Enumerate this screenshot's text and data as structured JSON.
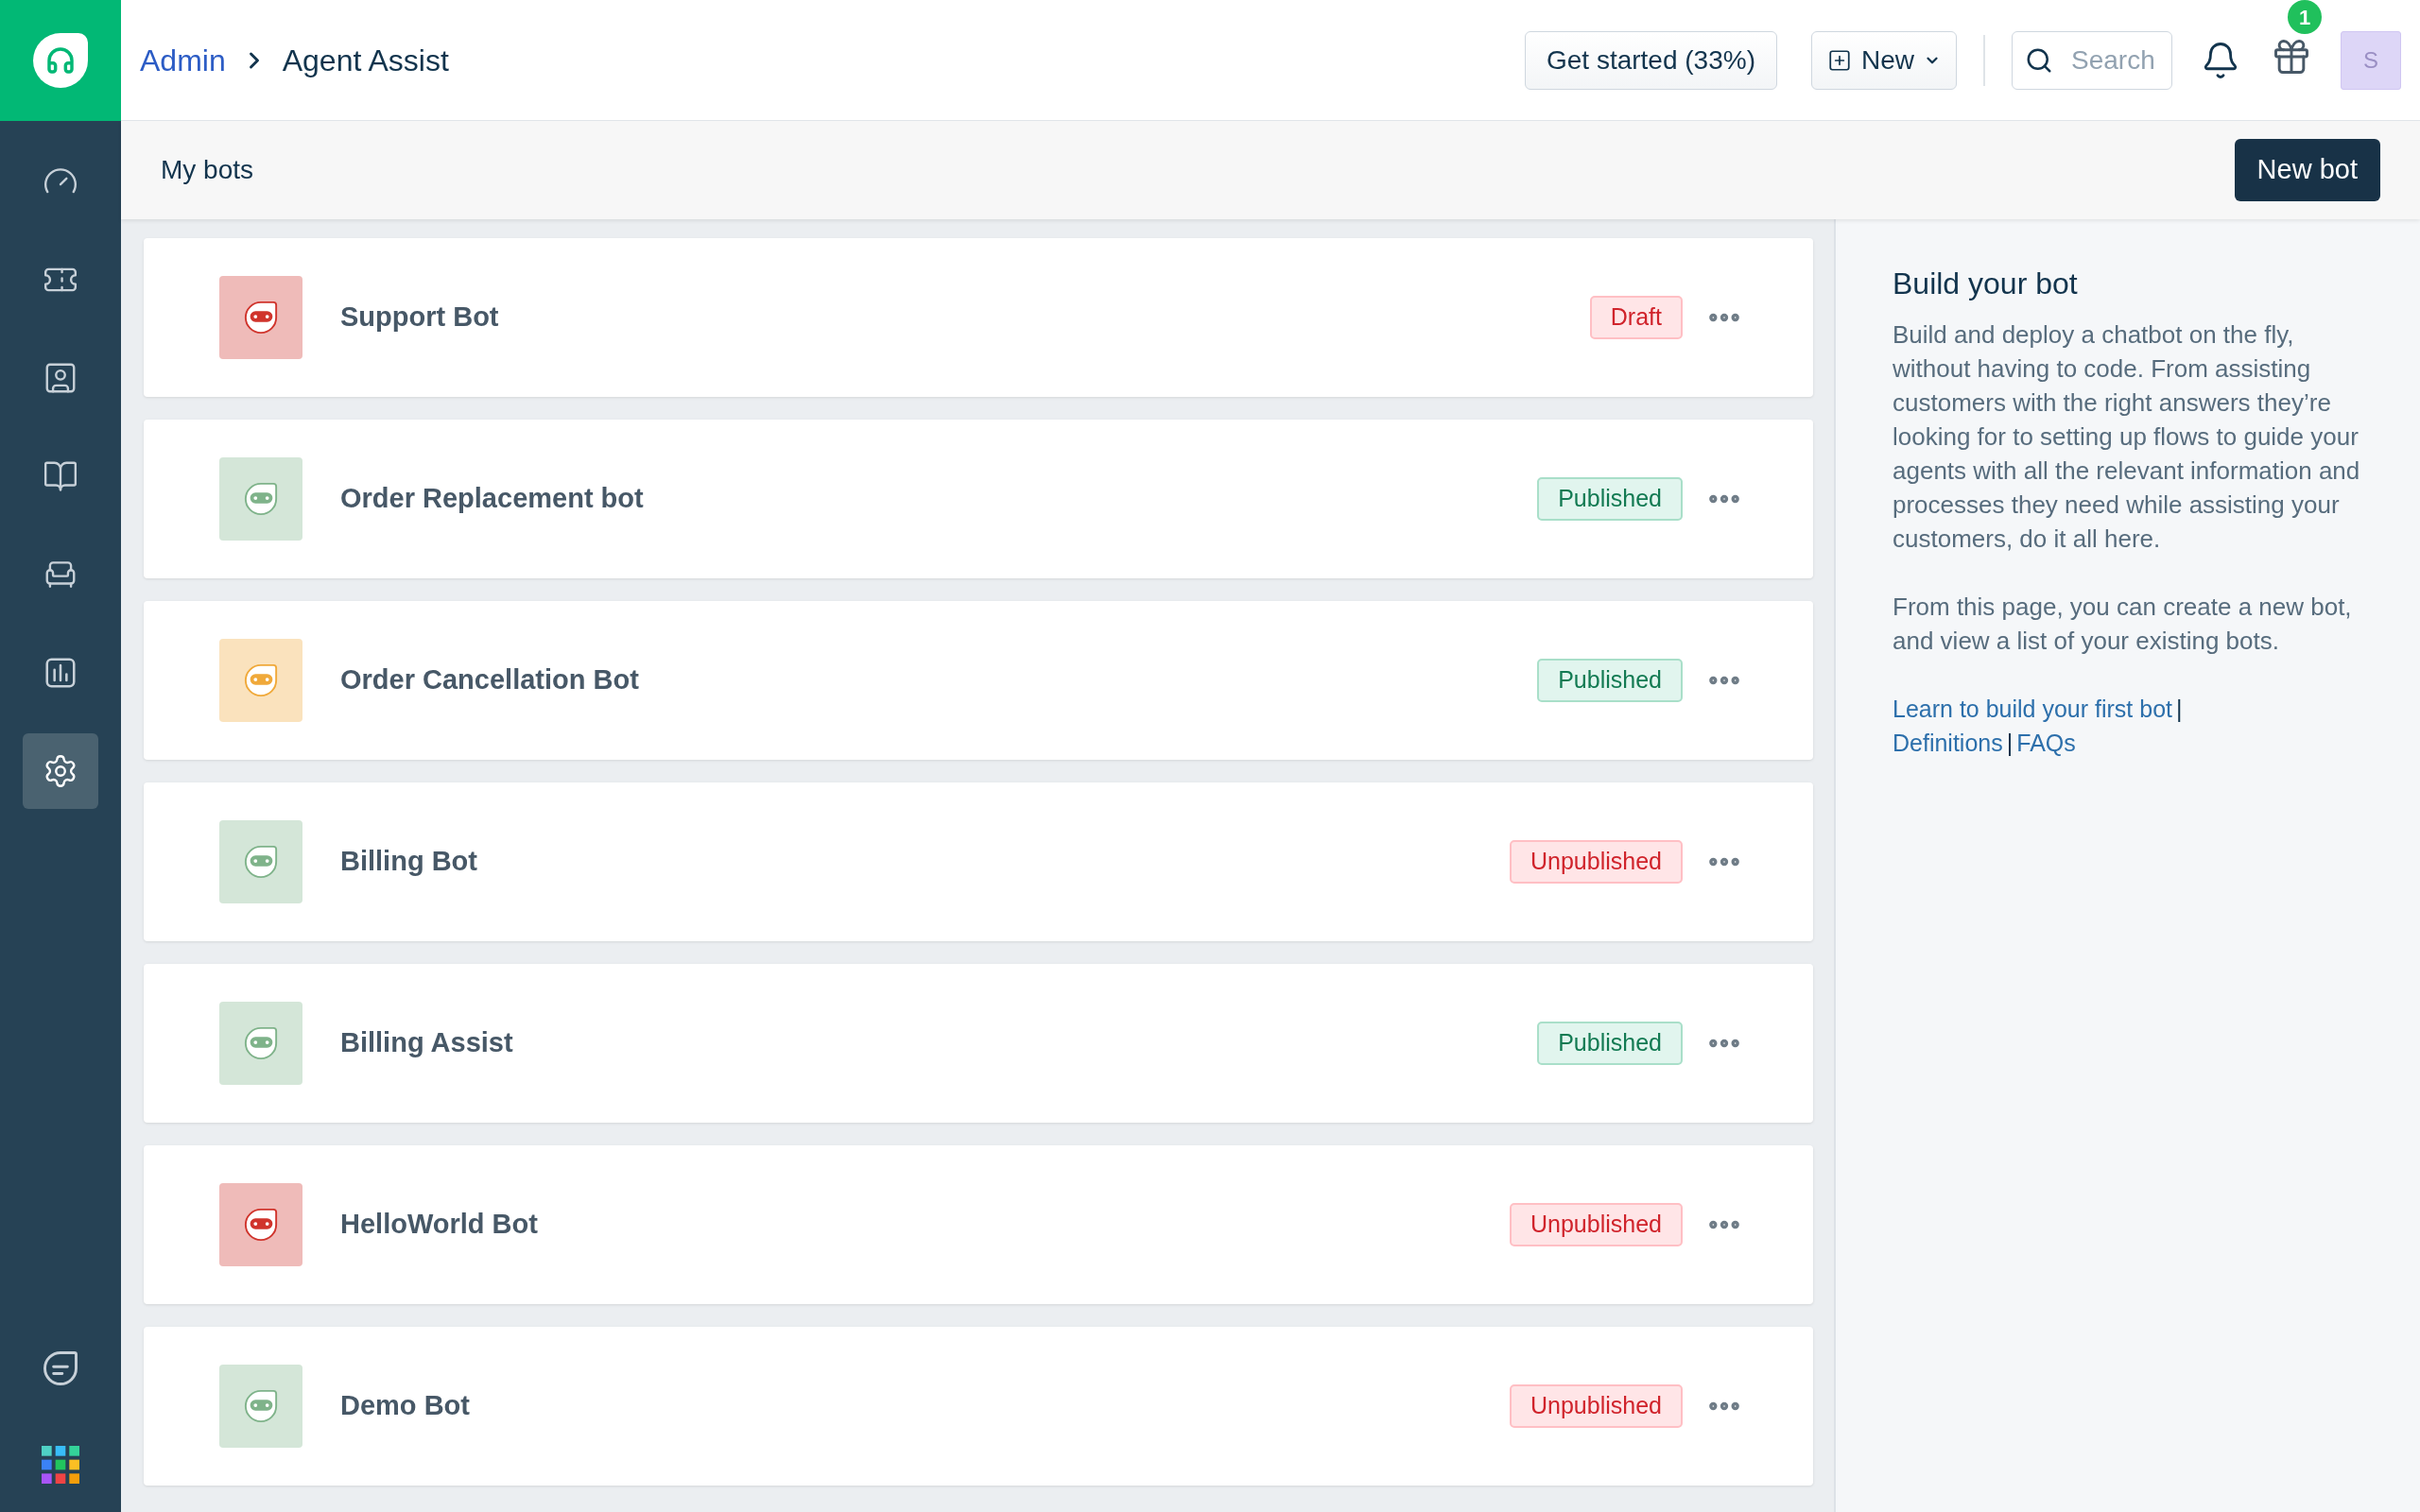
{
  "breadcrumb": {
    "parent": "Admin",
    "current": "Agent Assist"
  },
  "header": {
    "get_started": "Get started (33%)",
    "new_menu": "New",
    "search": {
      "placeholder": "Search"
    },
    "gift_badge": "1",
    "avatar": "S"
  },
  "sidebar": {
    "items": [
      {
        "kind": "dashboard",
        "selected": false
      },
      {
        "kind": "tickets",
        "selected": false
      },
      {
        "kind": "contacts",
        "selected": false
      },
      {
        "kind": "knowledge",
        "selected": false
      },
      {
        "kind": "assets",
        "selected": false
      },
      {
        "kind": "reports",
        "selected": false
      },
      {
        "kind": "settings",
        "selected": true
      }
    ],
    "bottom_items": [
      {
        "kind": "chat"
      },
      {
        "kind": "apps"
      }
    ]
  },
  "page": {
    "title": "My bots",
    "new_button": "New bot"
  },
  "bots": [
    {
      "name": "Support Bot",
      "color": "#d0342c",
      "status": "Draft",
      "kind": "draft"
    },
    {
      "name": "Order Replacement bot",
      "color": "#7fb38a",
      "status": "Published",
      "kind": "published"
    },
    {
      "name": "Order Cancellation Bot",
      "color": "#f0a93a",
      "status": "Published",
      "kind": "published"
    },
    {
      "name": "Billing Bot",
      "color": "#7fb38a",
      "status": "Unpublished",
      "kind": "unpublished"
    },
    {
      "name": "Billing Assist",
      "color": "#7fb38a",
      "status": "Published",
      "kind": "published"
    },
    {
      "name": "HelloWorld Bot",
      "color": "#d0342c",
      "status": "Unpublished",
      "kind": "unpublished"
    },
    {
      "name": "Demo Bot",
      "color": "#7fb38a",
      "status": "Unpublished",
      "kind": "unpublished"
    }
  ],
  "info_panel": {
    "title": "Build your bot",
    "paragraphs": [
      "Build and deploy a chatbot on the fly, without having to code. From assisting customers with the right answers they’re looking for to setting up flows to guide your agents with all the relevant information and processes they need while assisting your customers, do it all here.",
      "From this page, you can create a new bot, and view a list of your existing bots."
    ],
    "links": [
      "Learn to build your first bot",
      "Definitions",
      "FAQs"
    ],
    "separator": "|"
  }
}
